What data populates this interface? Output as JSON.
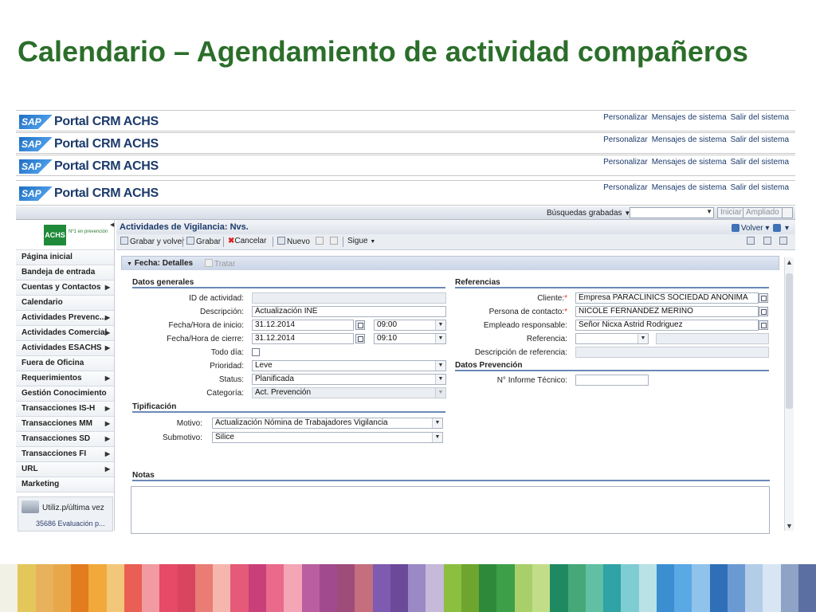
{
  "slide": {
    "title": "Calendario – Agendamiento de actividad compañeros"
  },
  "portal": {
    "logo": "SAP",
    "title": "Portal CRM ACHS",
    "links": [
      "Personalizar",
      "Mensajes de sistema",
      "Salir del sistema"
    ]
  },
  "search": {
    "label": "Búsquedas grabadas",
    "buttons": {
      "start": "Iniciar",
      "advanced": "Ampliado"
    }
  },
  "sidebar": {
    "logo": "ACHS",
    "logo_sub": "Nº1 en prevención",
    "items": [
      {
        "label": "Página inicial",
        "has_submenu": false
      },
      {
        "label": "Bandeja de entrada",
        "has_submenu": false
      },
      {
        "label": "Cuentas y Contactos",
        "has_submenu": true
      },
      {
        "label": "Calendario",
        "has_submenu": false
      },
      {
        "label": "Actividades Prevenc...",
        "has_submenu": true
      },
      {
        "label": "Actividades Comercial",
        "has_submenu": true
      },
      {
        "label": "Actividades ESACHS",
        "has_submenu": true
      },
      {
        "label": "Fuera de Oficina",
        "has_submenu": false
      },
      {
        "label": "Requerimientos",
        "has_submenu": true
      },
      {
        "label": "Gestión Conocimiento",
        "has_submenu": false
      },
      {
        "label": "Transacciones IS-H",
        "has_submenu": true
      },
      {
        "label": "Transacciones MM",
        "has_submenu": true
      },
      {
        "label": "Transacciones SD",
        "has_submenu": true
      },
      {
        "label": "Transacciones FI",
        "has_submenu": true
      },
      {
        "label": "URL",
        "has_submenu": true
      },
      {
        "label": "Marketing",
        "has_submenu": false
      }
    ],
    "recent": {
      "title": "Utiliz.p/última vez",
      "item": "35686 Evaluación p..."
    }
  },
  "main": {
    "title": "Actividades de Vigilancia: Nvs.",
    "back_label": "Volver",
    "toolbar": {
      "save_back": "Grabar y volver",
      "save": "Grabar",
      "cancel": "Cancelar",
      "new": "Nuevo",
      "next": "Sigue"
    },
    "tabs": {
      "active": "Fecha: Detalles",
      "inactive": "Tratar"
    }
  },
  "general": {
    "header": "Datos generales",
    "id_label": "ID de actividad:",
    "id_value": "",
    "desc_label": "Descripción:",
    "desc_value": "Actualización INE",
    "start_label": "Fecha/Hora de inicio:",
    "start_date": "31.12.2014",
    "start_time": "09:00",
    "end_label": "Fecha/Hora de cierre:",
    "end_date": "31.12.2014",
    "end_time": "09:10",
    "allday_label": "Todo día:",
    "priority_label": "Prioridad:",
    "priority_value": "Leve",
    "status_label": "Status:",
    "status_value": "Planificada",
    "category_label": "Categoría:",
    "category_value": "Act. Prevención"
  },
  "references": {
    "header": "Referencias",
    "client_label": "Cliente:",
    "client_value": "Empresa PARACLINICS SOCIEDAD ANONIMA",
    "contact_label": "Persona de contacto:",
    "contact_value": "NICOLE FERNÁNDEZ MERIÑO",
    "employee_label": "Empleado responsable:",
    "employee_value": "Señor Nicxa Astrid Rodriguez",
    "reference_label": "Referencia:",
    "reference_desc_label": "Descripción de referencia:"
  },
  "prevention": {
    "header": "Datos Prevención",
    "report_label": "N° Informe Técnico:",
    "report_value": ""
  },
  "typification": {
    "header": "Tipificación",
    "motive_label": "Motivo:",
    "motive_value": "Actualización Nómina de Trabajadores Vigilancia",
    "submotive_label": "Submotivo:",
    "submotive_value": "Silice"
  },
  "notes": {
    "header": "Notas",
    "value": ""
  },
  "colors": {
    "title_green": "#2b6e2a",
    "stripes": [
      "#f2f1e6",
      "#e4c75b",
      "#e7b25b",
      "#e8a84a",
      "#e27c1f",
      "#f0a93a",
      "#f2c77a",
      "#e95f54",
      "#f19aa1",
      "#e64a66",
      "#d9445f",
      "#e97c75",
      "#f5b6ae",
      "#e45a78",
      "#c93f77",
      "#e96a8b",
      "#f4a5b6",
      "#ba5ea0",
      "#a24a8e",
      "#9e4d7a",
      "#c46e7e",
      "#7e5bb0",
      "#6b4a9a",
      "#9a89c4",
      "#c6b9da",
      "#8cbf3f",
      "#6da52f",
      "#2e8a3a",
      "#3da049",
      "#a9cf6a",
      "#c2dd87",
      "#1f8a62",
      "#46a879",
      "#61bfa3",
      "#2fa3a6",
      "#7ecdd2",
      "#b8e2e6",
      "#3b8fd1",
      "#5aa8e4",
      "#8fc3ec",
      "#2f6fb8",
      "#6b9ad2",
      "#b3cde9",
      "#d8e6f4",
      "#8fa3c7",
      "#5b6fa3"
    ]
  }
}
